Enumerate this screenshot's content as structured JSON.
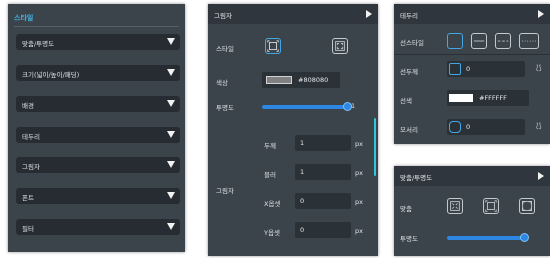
{
  "style_panel": {
    "title": "스타일",
    "sections": [
      "맞춤/투명도",
      "크기(넓이/높이/패딩)",
      "배경",
      "테두리",
      "그림자",
      "폰트",
      "필터"
    ]
  },
  "shadow_panel": {
    "header": "그림자",
    "style_label": "스타일",
    "color_label": "색상",
    "color_value": "#808080",
    "color_swatch": "#808080",
    "opacity_label": "투명도",
    "opacity_value": "1",
    "opacity_fraction": 1.0,
    "shadow_label": "그림자",
    "rows": [
      {
        "label": "두께",
        "value": "1",
        "unit": "px"
      },
      {
        "label": "블러",
        "value": "1",
        "unit": "px"
      },
      {
        "label": "X옵셋",
        "value": "0",
        "unit": "px"
      },
      {
        "label": "Y옵셋",
        "value": "0",
        "unit": "px"
      }
    ]
  },
  "border_panel": {
    "header": "테두리",
    "line_style_label": "선스타일",
    "line_thickness_label": "선두께",
    "line_thickness_value": "0",
    "line_color_label": "선색",
    "line_color_value": "#FFFFFF",
    "line_color_swatch": "#FFFFFF",
    "corner_label": "모서리",
    "corner_value": "0"
  },
  "align_panel": {
    "header": "맞춤/투명도",
    "align_label": "맞춤",
    "opacity_label": "투명도",
    "opacity_fraction": 0.95
  },
  "colors": {
    "accent": "#3FB6E8",
    "panel_bg": "#3B434B",
    "field_bg": "#2A3137",
    "slider_blue": "#2F87E4"
  }
}
